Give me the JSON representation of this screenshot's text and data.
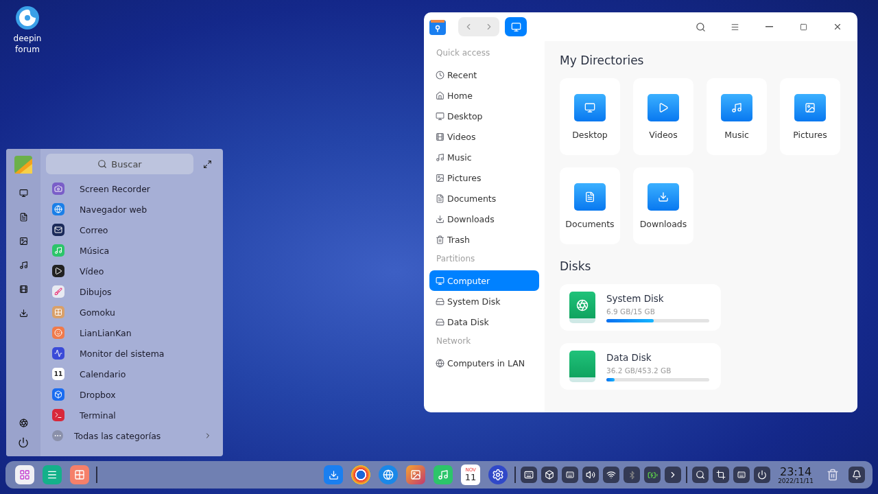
{
  "desktop_icons": [
    {
      "label": "deepin forum"
    }
  ],
  "launcher": {
    "search": {
      "placeholder": "Buscar"
    },
    "apps": [
      {
        "name": "Screen Recorder"
      },
      {
        "name": "Navegador web"
      },
      {
        "name": "Correo"
      },
      {
        "name": "Música"
      },
      {
        "name": "Vídeo"
      },
      {
        "name": "Dibujos"
      },
      {
        "name": "Gomoku"
      },
      {
        "name": "LianLianKan"
      },
      {
        "name": "Monitor del sistema"
      },
      {
        "name": "Calendario",
        "badge": "11"
      },
      {
        "name": "Dropbox"
      },
      {
        "name": "Terminal"
      }
    ],
    "all_categories": "Todas las categorías"
  },
  "file_manager": {
    "sidebar": [
      {
        "heading": "Quick access",
        "items": [
          {
            "label": "Recent",
            "selected": false
          },
          {
            "label": "Home",
            "selected": false
          },
          {
            "label": "Desktop",
            "selected": false
          },
          {
            "label": "Videos",
            "selected": false
          },
          {
            "label": "Music",
            "selected": false
          },
          {
            "label": "Pictures",
            "selected": false
          },
          {
            "label": "Documents",
            "selected": false
          },
          {
            "label": "Downloads",
            "selected": false
          },
          {
            "label": "Trash",
            "selected": false
          }
        ]
      },
      {
        "heading": "Partitions",
        "items": [
          {
            "label": "Computer",
            "selected": true
          },
          {
            "label": "System Disk",
            "selected": false
          },
          {
            "label": "Data Disk",
            "selected": false
          }
        ]
      },
      {
        "heading": "Network",
        "items": [
          {
            "label": "Computers in LAN",
            "selected": false
          }
        ]
      }
    ],
    "directories_heading": "My Directories",
    "directories": [
      {
        "label": "Desktop"
      },
      {
        "label": "Videos"
      },
      {
        "label": "Music"
      },
      {
        "label": "Pictures"
      },
      {
        "label": "Documents"
      },
      {
        "label": "Downloads"
      }
    ],
    "disks_heading": "Disks",
    "disks": [
      {
        "name": "System Disk",
        "usage": "6.9 GB/15 GB",
        "level": 0.46,
        "kind": "system"
      },
      {
        "name": "Data Disk",
        "usage": "36.2 GB/453.2 GB",
        "level": 0.08,
        "kind": "data"
      }
    ]
  },
  "dock": {
    "calendar": {
      "month": "NOV",
      "day": "11"
    },
    "time": "23:14",
    "date": "2022/11/11"
  }
}
